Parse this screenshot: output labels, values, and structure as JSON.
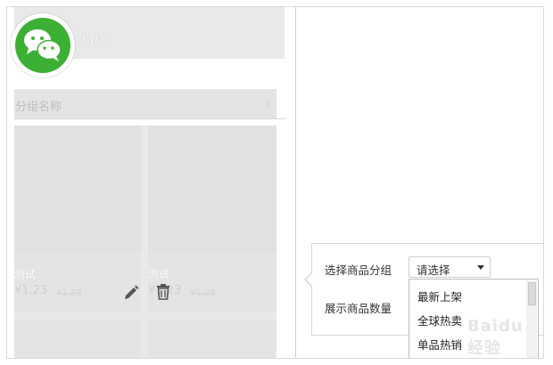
{
  "shop": {
    "name": "微信"
  },
  "group_bar": {
    "label": "分组名称",
    "chevron": "›"
  },
  "goods": [
    {
      "name": "测试",
      "price": "¥1.23",
      "orig_price": "¥1.23"
    },
    {
      "name": "测试",
      "price": "¥1.23",
      "orig_price": "¥1.23"
    }
  ],
  "config": {
    "select_group_label": "选择商品分组",
    "select_value": "请选择",
    "count_label": "展示商品数量",
    "options": [
      "最新上架",
      "全球热卖",
      "单品热销"
    ]
  },
  "colors": {
    "logo": "#3cb034"
  },
  "icons": {
    "logo": "wechat-icon",
    "edit": "pencil-icon",
    "delete": "trash-icon",
    "chevron": "chevron-right-icon"
  },
  "watermark": "Baidu 经验"
}
